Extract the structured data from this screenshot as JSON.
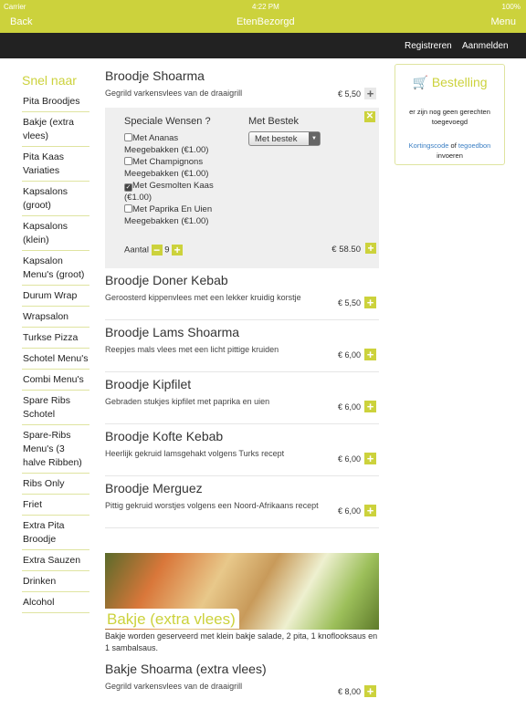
{
  "status": {
    "carrier": "Carrier",
    "time": "4:22 PM",
    "battery": "100%"
  },
  "nav": {
    "back": "Back",
    "title": "EtenBezorgd",
    "menu": "Menu"
  },
  "account": {
    "register": "Registreren",
    "login": "Aanmelden"
  },
  "sidebar": {
    "title": "Snel naar",
    "items": [
      "Pita Broodjes",
      "Bakje (extra vlees)",
      "Pita Kaas Variaties",
      "Kapsalons (groot)",
      "Kapsalons (klein)",
      "Kapsalon Menu's (groot)",
      "Durum Wrap",
      "Wrapsalon",
      "Turkse Pizza",
      "Schotel Menu's",
      "Combi Menu's",
      "Spare Ribs Schotel",
      "Spare-Ribs Menu's (3 halve Ribben)",
      "Ribs Only",
      "Friet",
      "Extra Pita Broodje",
      "Extra Sauzen",
      "Drinken",
      "Alcohol"
    ]
  },
  "expanded": {
    "name": "Broodje Shoarma",
    "desc": "Gegrild varkensvlees van de draaigrill",
    "price": "€ 5,50",
    "wishes_title": "Speciale Wensen ?",
    "options": [
      {
        "label": "Met Ananas Meegebakken (€1.00)",
        "checked": false
      },
      {
        "label": "Met Champignons Meegebakken (€1.00)",
        "checked": false
      },
      {
        "label": "Met Gesmolten Kaas (€1.00)",
        "checked": true
      },
      {
        "label": "Met Paprika En Uien Meegebakken (€1.00)",
        "checked": false
      }
    ],
    "cutlery_title": "Met Bestek",
    "cutlery_value": "Met bestek",
    "qty_label": "Aantal",
    "qty": "9",
    "total": "€ 58.50"
  },
  "products": [
    {
      "name": "Broodje Doner Kebab",
      "desc": "Geroosterd kippenvlees met een lekker kruidig korstje",
      "price": "€ 5,50"
    },
    {
      "name": "Broodje Lams Shoarma",
      "desc": "Reepjes mals vlees met een licht pittige kruiden",
      "price": "€ 6,00"
    },
    {
      "name": "Broodje Kipfilet",
      "desc": "Gebraden stukjes kipfilet met paprika en uien",
      "price": "€ 6,00"
    },
    {
      "name": "Broodje Kofte Kebab",
      "desc": "Heerlijk gekruid lamsgehakt volgens Turks recept",
      "price": "€ 6,00"
    },
    {
      "name": "Broodje Merguez",
      "desc": "Pittig gekruid worstjes volgens een Noord-Afrikaans recept",
      "price": "€ 6,00"
    }
  ],
  "category": {
    "title": "Bakje (extra vlees)",
    "desc": "Bakje worden geserveerd met klein bakje salade, 2 pita, 1 knoflooksaus en 1 sambalsaus.",
    "first": {
      "name": "Bakje Shoarma (extra vlees)",
      "desc": "Gegrild varkensvlees van de draaigrill",
      "price": "€ 8,00"
    }
  },
  "order": {
    "title": "Bestelling",
    "empty": "er zijn nog geen gerechten toegevoegd",
    "coupon": "Kortingscode",
    "of": "of",
    "voucher": "tegoedbon",
    "enter": "invoeren"
  },
  "colors": {
    "accent": "#ccd23c",
    "dark": "#222222",
    "link": "#3b7fc4"
  }
}
